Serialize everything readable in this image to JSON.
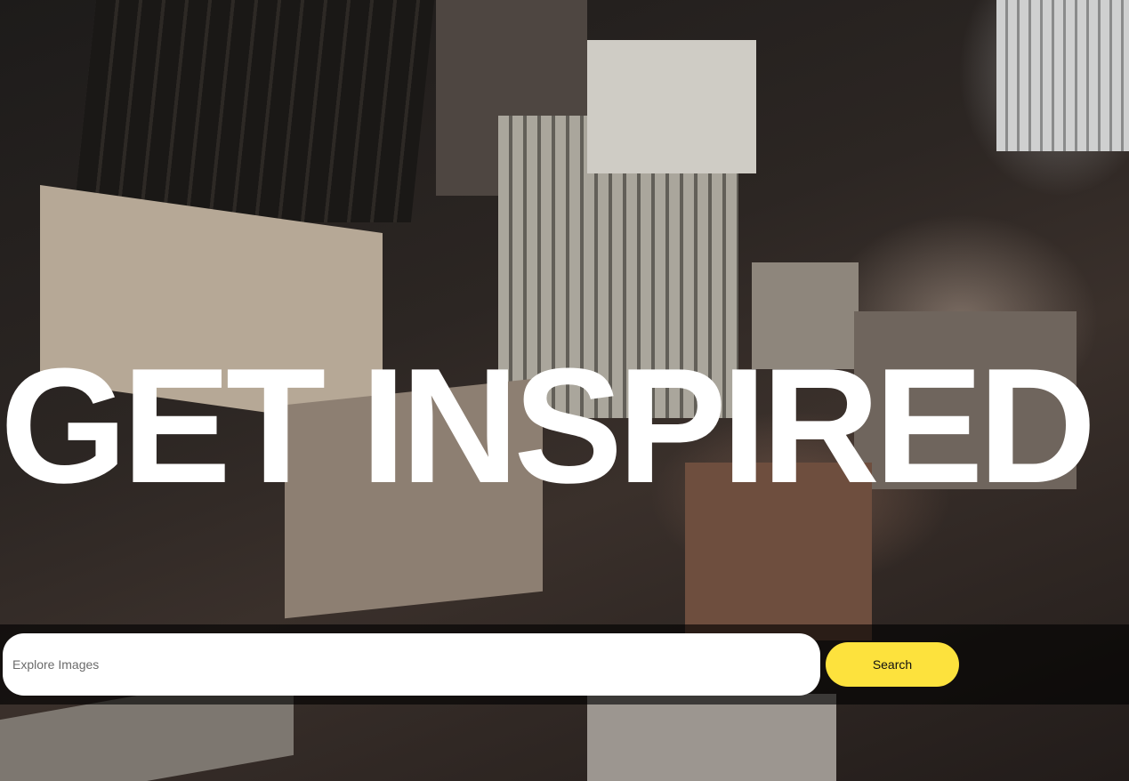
{
  "hero": {
    "headline": "GET INSPIRED",
    "background_image": "aerial-city-buildings"
  },
  "search": {
    "placeholder": "Explore Images",
    "value": "",
    "button_label": "Search"
  },
  "colors": {
    "headline": "#ffffff",
    "search_button": "#fde23d",
    "search_bar_backdrop": "rgba(0,0,0,0.62)"
  }
}
